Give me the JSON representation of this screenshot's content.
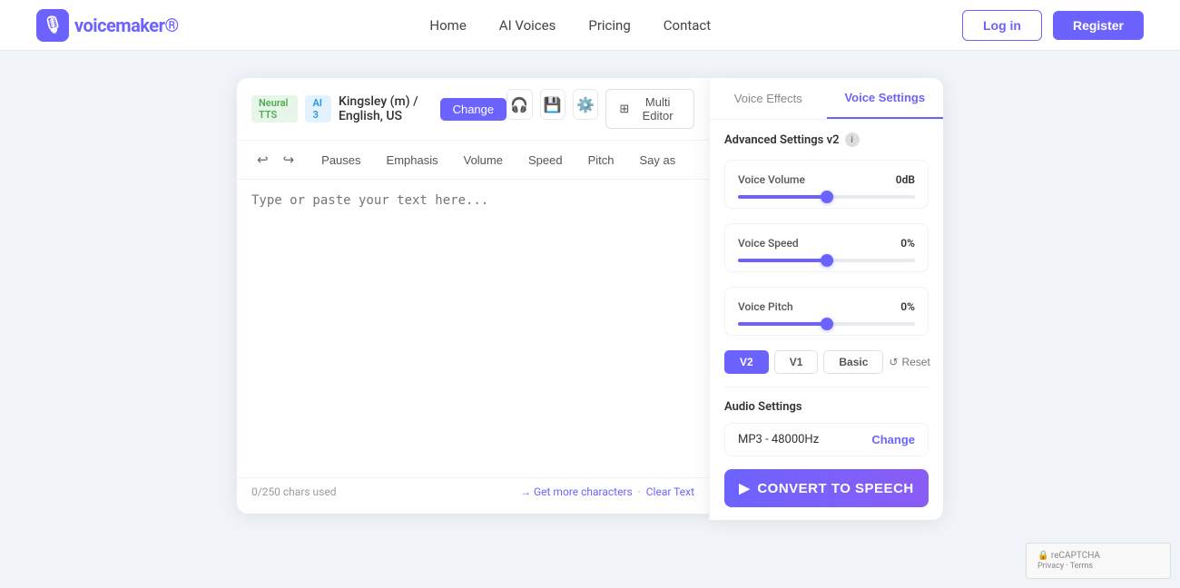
{
  "navbar": {
    "logo_text": "voicemaker",
    "logo_suffix": "®",
    "links": [
      {
        "label": "Home",
        "id": "home"
      },
      {
        "label": "AI Voices",
        "id": "ai-voices"
      },
      {
        "label": "Pricing",
        "id": "pricing"
      },
      {
        "label": "Contact",
        "id": "contact"
      }
    ],
    "login_label": "Log in",
    "register_label": "Register"
  },
  "editor": {
    "badge_neural": "Neural TTS",
    "badge_ai": "AI 3",
    "voice_name": "Kingsley (m) / English, US",
    "change_label": "Change",
    "toolbar_tabs": [
      "Pauses",
      "Emphasis",
      "Volume",
      "Speed",
      "Pitch",
      "Say as"
    ],
    "chars_used": "0/250 chars used",
    "get_more_label": "→ Get more characters",
    "clear_text_label": "Clear Text",
    "multi_editor_label": "Multi Editor",
    "placeholder": ""
  },
  "settings": {
    "tab_effects": "Voice Effects",
    "tab_settings": "Voice Settings",
    "advanced_label": "Advanced Settings v2",
    "voice_volume_label": "Voice Volume",
    "voice_volume_value": "0dB",
    "voice_volume_pct": 50,
    "voice_speed_label": "Voice Speed",
    "voice_speed_value": "0%",
    "voice_speed_pct": 50,
    "voice_pitch_label": "Voice Pitch",
    "voice_pitch_value": "0%",
    "voice_pitch_pct": 50,
    "version_buttons": [
      "V2",
      "V1",
      "Basic"
    ],
    "active_version": "V2",
    "reset_label": "Reset",
    "audio_settings_label": "Audio Settings",
    "audio_format": "MP3 - 48000Hz",
    "change_audio_label": "Change",
    "convert_label": "CONVERT TO SPEECH"
  }
}
